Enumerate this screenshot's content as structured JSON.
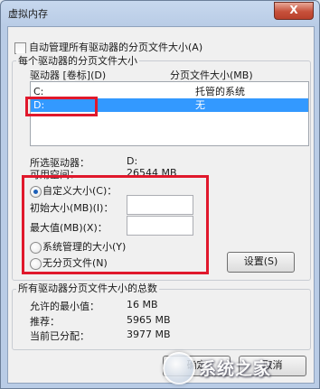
{
  "window": {
    "title": "虚拟内存",
    "close_glyph": "X"
  },
  "auto_manage": {
    "label": "自动管理所有驱动器的分页文件大小(A)",
    "checked": false
  },
  "drive_group": {
    "legend": "每个驱动器的分页文件大小",
    "columns": {
      "drive": "驱动器 [卷标](D)",
      "size": "分页文件大小(MB)"
    },
    "rows": [
      {
        "drive": "C:",
        "size": "托管的系统",
        "selected": false
      },
      {
        "drive": "D:",
        "size": "无",
        "selected": true
      }
    ],
    "selected_drive_label": "所选驱动器：",
    "selected_drive_value": "D:",
    "free_space_label": "可用空间：",
    "free_space_value": "26544 MB",
    "custom_size_label": "自定义大小(C)：",
    "initial_size_label": "初始大小(MB)(I)：",
    "initial_size_value": "",
    "max_size_label": "最大值(MB)(X)：",
    "max_size_value": "",
    "system_managed_label": "系统管理的大小(Y)",
    "no_paging_label": "无分页文件(N)",
    "set_button": "设置(S)",
    "selected_option": "custom"
  },
  "total_group": {
    "legend": "所有驱动器分页文件大小的总数",
    "min_label": "允许的最小值：",
    "min_value": "16 MB",
    "recommended_label": "推荐：",
    "recommended_value": "5965 MB",
    "allocated_label": "当前已分配：",
    "allocated_value": "3977 MB"
  },
  "buttons": {
    "ok": "确定",
    "cancel": "取消"
  },
  "watermark": {
    "text": "系统之家"
  },
  "colors": {
    "selection": "#3399ff",
    "highlight_box": "#e0182c"
  }
}
